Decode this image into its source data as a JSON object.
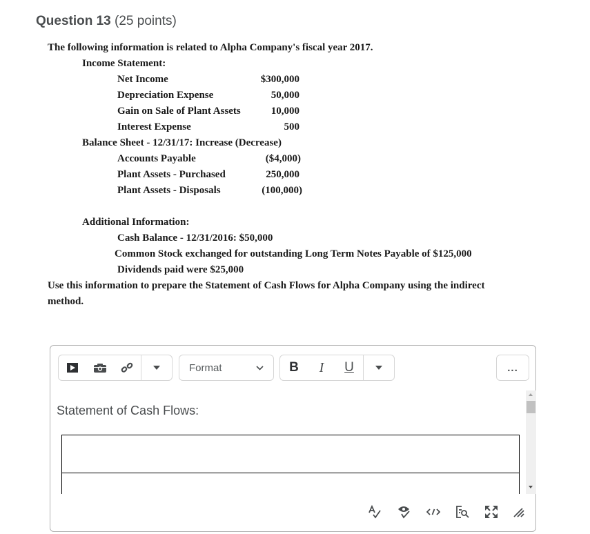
{
  "question": {
    "number_label": "Question 13",
    "points_label": "(25 points)"
  },
  "problem": {
    "intro": "The following information is related to Alpha Company's fiscal year 2017.",
    "income_statement": {
      "heading": "Income Statement:",
      "rows": [
        {
          "label": "Net Income",
          "value": "$300,000"
        },
        {
          "label": "Depreciation Expense",
          "value": "50,000"
        },
        {
          "label": "Gain on Sale of Plant Assets",
          "value": "10,000"
        },
        {
          "label": "Interest Expense",
          "value": "500"
        }
      ]
    },
    "balance_sheet": {
      "heading": "Balance Sheet - 12/31/17: Increase (Decrease)",
      "rows": [
        {
          "label": "Accounts Payable",
          "value": "($4,000)"
        },
        {
          "label": "Plant Assets - Purchased",
          "value": "250,000"
        },
        {
          "label": "Plant Assets - Disposals",
          "value": "(100,000)"
        }
      ]
    },
    "additional": {
      "heading": "Additional Information:",
      "items": [
        "Cash Balance - 12/31/2016:  $50,000",
        "Common Stock exchanged for outstanding Long Term Notes Payable of $125,000",
        "Dividends paid were $25,000"
      ]
    },
    "instruction_line1": "Use this information to prepare the Statement of Cash Flows for Alpha Company using the indirect",
    "instruction_line2": "method."
  },
  "editor": {
    "toolbar": {
      "insert_group": [
        "insert-video",
        "insert-image",
        "insert-link",
        "more-insert"
      ],
      "format_select": {
        "selected": "Format"
      },
      "text_style": {
        "bold": "B",
        "italic": "I",
        "underline": "U"
      },
      "more_label": "..."
    },
    "content": {
      "title": "Statement of Cash Flows:",
      "table_rows": 2
    },
    "bottom_bar_icons": [
      "spellcheck-icon",
      "accessibility-check-icon",
      "source-code-icon",
      "preview-icon",
      "fullscreen-icon",
      "resize-handle-icon"
    ]
  }
}
